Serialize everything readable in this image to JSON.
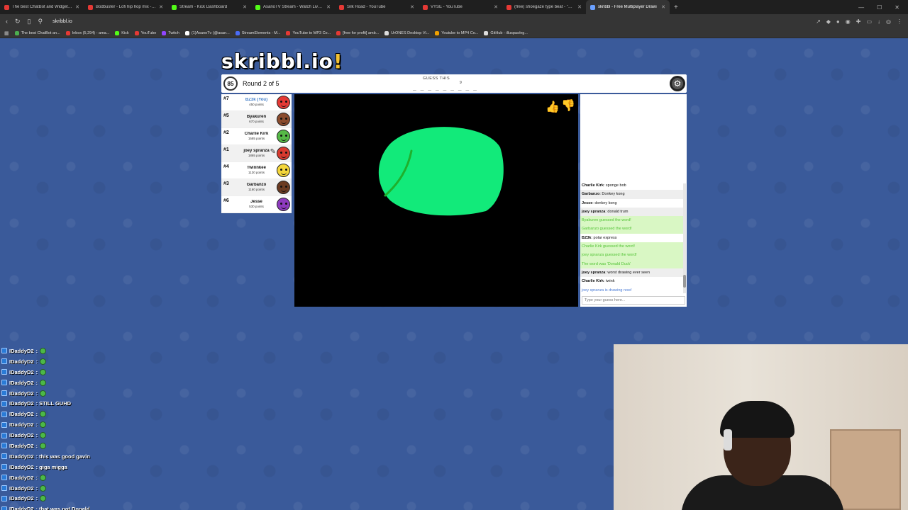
{
  "browser": {
    "tabs": [
      {
        "title": "The best ChatBot and Widgets for Kick",
        "color": "#e53935",
        "active": false
      },
      {
        "title": "Bodbuster - Lofi hip hop mix - 6...",
        "color": "#e53935",
        "active": false
      },
      {
        "title": "Stream - Kick Dashboard",
        "color": "#53fc18",
        "active": false
      },
      {
        "title": "AsanoTV Stream - Watch Live on Kick",
        "color": "#53fc18",
        "active": false
      },
      {
        "title": "Silk Road - YouTube",
        "color": "#e53935",
        "active": false
      },
      {
        "title": "VYSE - YouTube",
        "color": "#e53935",
        "active": false
      },
      {
        "title": "(free) shoegaze type beat - \"Abandc",
        "color": "#e53935",
        "active": false
      },
      {
        "title": "skribbl - Free Multiplayer Drawi",
        "color": "#6aa0ff",
        "active": true
      }
    ],
    "url": "skribbl.io",
    "bookmarks": [
      {
        "label": "The best ChatBot an...",
        "color": "#4caf50"
      },
      {
        "label": "Inbox (5,294) - ama...",
        "color": "#e53935"
      },
      {
        "label": "Kick",
        "color": "#53fc18"
      },
      {
        "label": "YouTube",
        "color": "#e53935"
      },
      {
        "label": "Twitch",
        "color": "#9146ff"
      },
      {
        "label": "(1)AsanoTv (@asan...",
        "color": "#ffffff"
      },
      {
        "label": "StreamElements - M...",
        "color": "#4a6cf7"
      },
      {
        "label": "YouTube to MP3 Co...",
        "color": "#e53935"
      },
      {
        "label": "[free for profit] amb...",
        "color": "#e53935"
      },
      {
        "label": "UrONES Desktop Vi...",
        "color": "#dddddd"
      },
      {
        "label": "Youtube to MP4 Co...",
        "color": "#f0a000"
      },
      {
        "label": "GitHub - illuspas/ng...",
        "color": "#dddddd"
      }
    ]
  },
  "game": {
    "logo_main": "skribbl.io",
    "logo_bang": "!",
    "timer": "85",
    "round": "Round 2 of 5",
    "guess_label": "GUESS THIS",
    "guess_blanks": "_ _ _ _ _ _ _ _ _",
    "guess_count": "9",
    "players": [
      {
        "rank": "#7",
        "name": "BZ3k (You)",
        "points": "450 points",
        "avatar_color": "#e53935",
        "me": true
      },
      {
        "rank": "#5",
        "name": "Byakuren",
        "points": "670 points",
        "avatar_color": "#8a4b2d",
        "me": false
      },
      {
        "rank": "#2",
        "name": "Charlie Kirk",
        "points": "1585 points",
        "avatar_color": "#56b947",
        "me": false
      },
      {
        "rank": "#1",
        "name": "joey spranza",
        "points": "1865 points",
        "avatar_color": "#d83a2f",
        "me": false
      },
      {
        "rank": "#4",
        "name": "Twinnkee",
        "points": "1130 points",
        "avatar_color": "#f4d63b",
        "me": false
      },
      {
        "rank": "#3",
        "name": "Garbanzo",
        "points": "1160 points",
        "avatar_color": "#6b3b22",
        "me": false
      },
      {
        "rank": "#6",
        "name": "Jesse",
        "points": "530 points",
        "avatar_color": "#8e3bbf",
        "me": false
      }
    ],
    "chat": [
      {
        "user": "Charlie Kirk",
        "msg": " sponge bob",
        "style": "normal"
      },
      {
        "user": "Garbanzo",
        "msg": " Donkey kong",
        "style": "gray"
      },
      {
        "user": "Jesse",
        "msg": " donkey kong",
        "style": "normal"
      },
      {
        "user": "joey spranza",
        "msg": " donald trum",
        "style": "gray"
      },
      {
        "user": "",
        "msg": "Byakuren guessed the word!",
        "style": "green"
      },
      {
        "user": "",
        "msg": "Garbanzo guessed the word!",
        "style": "green"
      },
      {
        "user": "BZ3k",
        "msg": " polar express",
        "style": "normal"
      },
      {
        "user": "",
        "msg": "Charlie Kirk guessed the word!",
        "style": "green"
      },
      {
        "user": "",
        "msg": "joey spranza guessed the word!",
        "style": "green"
      },
      {
        "user": "",
        "msg": "The word was 'Donald Duck'",
        "style": "green"
      },
      {
        "user": "joey spranza",
        "msg": " worst drawing ever seen",
        "style": "gray"
      },
      {
        "user": "Charlie Kirk",
        "msg": " twink",
        "style": "normal"
      },
      {
        "user": "",
        "msg": "joey spranza is drawing now!",
        "style": "blue"
      }
    ],
    "chat_placeholder": "Type your guess here...",
    "drawing_colors": {
      "fill": "#12ea7a",
      "stroke": "#1fb02c"
    }
  },
  "stream_chat": [
    {
      "user": "IDaddyD2",
      "text": " : ",
      "emote": true
    },
    {
      "user": "IDaddyD2",
      "text": " : ",
      "emote": true
    },
    {
      "user": "IDaddyD2",
      "text": " : ",
      "emote": true
    },
    {
      "user": "IDaddyD2",
      "text": " : ",
      "emote": true
    },
    {
      "user": "IDaddyD2",
      "text": " : ",
      "emote": true
    },
    {
      "user": "IDaddyD2",
      "text": " : STILL GUHD",
      "emote": false
    },
    {
      "user": "IDaddyD2",
      "text": " : ",
      "emote": true
    },
    {
      "user": "IDaddyD2",
      "text": " : ",
      "emote": true
    },
    {
      "user": "IDaddyD2",
      "text": " : ",
      "emote": true
    },
    {
      "user": "IDaddyD2",
      "text": " : ",
      "emote": true
    },
    {
      "user": "IDaddyD2",
      "text": " : this was good gavin",
      "emote": false
    },
    {
      "user": "IDaddyD2",
      "text": " : giga migga",
      "emote": false
    },
    {
      "user": "IDaddyD2",
      "text": " : ",
      "emote": true
    },
    {
      "user": "IDaddyD2",
      "text": " : ",
      "emote": true
    },
    {
      "user": "IDaddyD2",
      "text": " : ",
      "emote": true
    },
    {
      "user": "IDaddyD2",
      "text": " : that was not Donald",
      "emote": false
    }
  ]
}
